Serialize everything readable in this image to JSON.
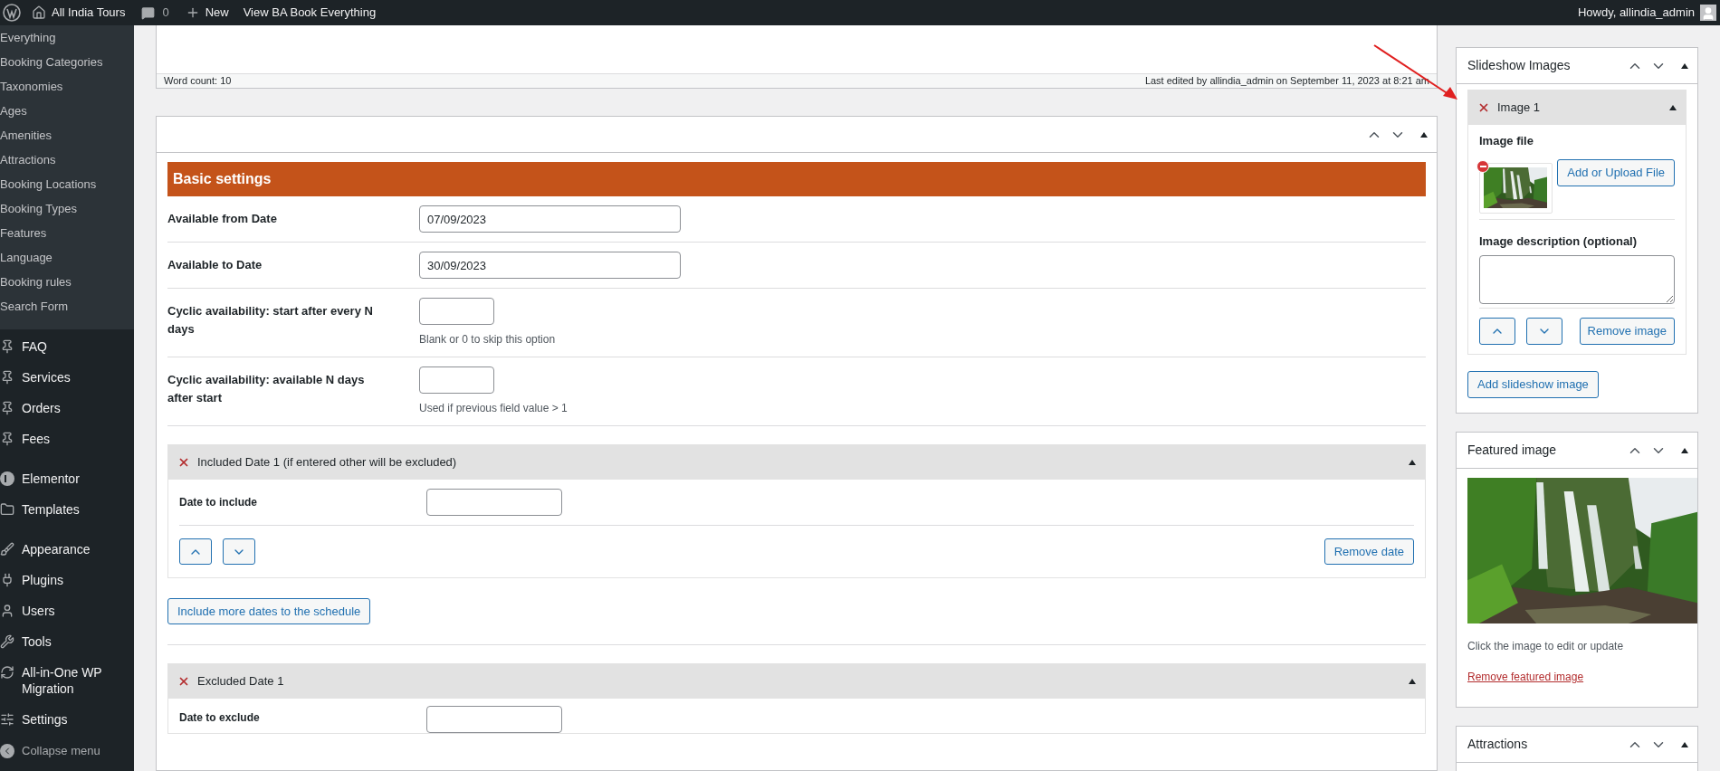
{
  "admin_bar": {
    "site": "All India Tours",
    "comments": "0",
    "new": "New",
    "view": "View BA Book Everything",
    "howdy": "Howdy, allindia_admin"
  },
  "sidebar": {
    "submenu": [
      "Everything",
      "Booking Categories",
      "Taxonomies",
      "Ages",
      "Amenities",
      "Attractions",
      "Booking Locations",
      "Booking Types",
      "Features",
      "Language",
      "Booking rules",
      "Search Form"
    ],
    "menu": [
      {
        "label": "FAQ"
      },
      {
        "label": "Services"
      },
      {
        "label": "Orders"
      },
      {
        "label": "Fees"
      },
      {
        "label": "Elementor"
      },
      {
        "label": "Templates"
      },
      {
        "label": "Appearance"
      },
      {
        "label": "Plugins"
      },
      {
        "label": "Users"
      },
      {
        "label": "Tools"
      },
      {
        "label": "All-in-One WP Migration"
      },
      {
        "label": "Settings"
      }
    ],
    "collapse": "Collapse menu"
  },
  "editor": {
    "word_count": "Word count: 10",
    "last_edited": "Last edited by allindia_admin on September 11, 2023 at 8:21 am"
  },
  "settings": {
    "section": "Basic settings",
    "fields": [
      {
        "label": "Available from Date",
        "kind": "date",
        "value": "07/09/2023"
      },
      {
        "label": "Available to Date",
        "kind": "date",
        "value": "30/09/2023"
      },
      {
        "label": "Cyclic availability: start after every N days",
        "kind": "number",
        "hint": "Blank or 0 to skip this option"
      },
      {
        "label": "Cyclic availability: available N days after start",
        "kind": "number",
        "hint": "Used if previous field value > 1"
      }
    ],
    "included": {
      "title": "Included Date 1 (if entered other will be excluded)",
      "field_label": "Date to include",
      "remove": "Remove date"
    },
    "include_more": "Include more dates to the schedule",
    "excluded": {
      "title": "Excluded Date 1",
      "field_label": "Date to exclude"
    }
  },
  "slideshow": {
    "title": "Slideshow Images",
    "item_title": "Image 1",
    "file_label": "Image file",
    "upload": "Add or Upload File",
    "desc_label": "Image description (optional)",
    "remove": "Remove image",
    "add": "Add slideshow image"
  },
  "featured": {
    "title": "Featured image",
    "hint": "Click the image to edit or update",
    "remove": "Remove featured image"
  },
  "attractions": {
    "title": "Attractions"
  }
}
